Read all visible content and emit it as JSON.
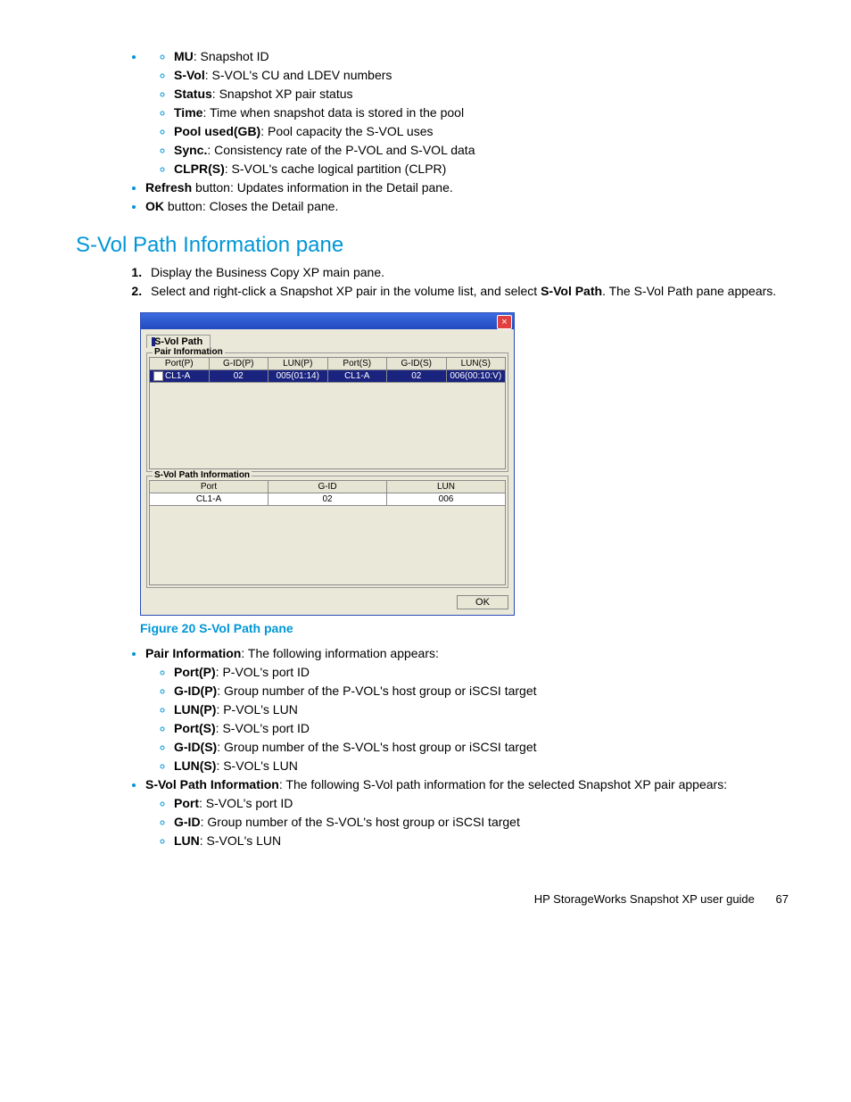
{
  "list1": {
    "mu_t": "MU",
    "mu_d": ": Snapshot ID",
    "svol_t": "S-Vol",
    "svol_d": ": S-VOL's CU and LDEV numbers",
    "status_t": "Status",
    "status_d": ": Snapshot XP pair status",
    "time_t": "Time",
    "time_d": ": Time when snapshot data is stored in the pool",
    "pool_t": "Pool used(GB)",
    "pool_d": ": Pool capacity the S-VOL uses",
    "sync_t": "Sync.",
    "sync_d": ": Consistency rate of the P-VOL and S-VOL data",
    "clpr_t": "CLPR(S)",
    "clpr_d": ": S-VOL's cache logical partition (CLPR)"
  },
  "outer": {
    "refresh_t": "Refresh",
    "refresh_d": " button: Updates information in the Detail pane.",
    "ok_t": "OK",
    "ok_d": " button: Closes the Detail pane."
  },
  "heading": "S-Vol Path Information pane",
  "steps": {
    "s1": "Display the Business Copy XP main pane.",
    "s2a": "Select and right-click a Snapshot XP pair in the volume list, and select ",
    "s2b": "S-Vol Path",
    "s2c": ". The S-Vol Path pane appears."
  },
  "shot": {
    "tab": "S-Vol Path",
    "pair_legend": "Pair Information",
    "pair_hdr": {
      "c1": "Port(P)",
      "c2": "G-ID(P)",
      "c3": "LUN(P)",
      "c4": "Port(S)",
      "c5": "G-ID(S)",
      "c6": "LUN(S)"
    },
    "pair_row": {
      "c1": "CL1-A",
      "c2": "02",
      "c3": "005(01:14)",
      "c4": "CL1-A",
      "c5": "02",
      "c6": "006(00:10:V)"
    },
    "path_legend": "S-Vol Path Information",
    "path_hdr": {
      "c1": "Port",
      "c2": "G-ID",
      "c3": "LUN"
    },
    "path_row": {
      "c1": "CL1-A",
      "c2": "02",
      "c3": "006"
    },
    "ok": "OK",
    "close": "×"
  },
  "figcap": "Figure 20 S-Vol Path pane",
  "pi": {
    "hdr_t": "Pair Information",
    "hdr_d": ": The following information appears:",
    "pp_t": "Port(P)",
    "pp_d": ": P-VOL's port ID",
    "gp_t": "G-ID(P)",
    "gp_d": ": Group number of the P-VOL's host group or iSCSI target",
    "lp_t": "LUN(P)",
    "lp_d": ": P-VOL's LUN",
    "ps_t": "Port(S)",
    "ps_d": ": S-VOL's port ID",
    "gs_t": "G-ID(S)",
    "gs_d": ": Group number of the S-VOL's host group or iSCSI target",
    "ls_t": "LUN(S)",
    "ls_d": ": S-VOL's LUN"
  },
  "sp": {
    "hdr_t": "S-Vol Path Information",
    "hdr_d": ": The following S-Vol path information for the selected Snapshot XP pair appears:",
    "port_t": "Port",
    "port_d": ": S-VOL's port ID",
    "gid_t": "G-ID",
    "gid_d": ": Group number of the S-VOL's host group or iSCSI target",
    "lun_t": "LUN",
    "lun_d": ": S-VOL's LUN"
  },
  "footer": {
    "title": "HP StorageWorks Snapshot XP user guide",
    "page": "67"
  }
}
